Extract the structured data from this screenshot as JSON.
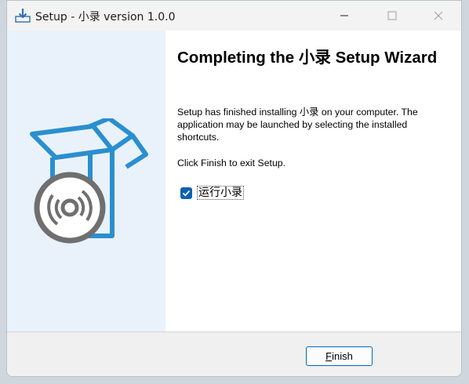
{
  "window": {
    "title": "Setup - 小录 version 1.0.0",
    "minimize_icon": "minimize-icon",
    "maximize_icon": "maximize-icon",
    "close_icon": "close-icon"
  },
  "wizard": {
    "heading": "Completing the 小录 Setup Wizard",
    "message": "Setup has finished installing 小录 on your computer. The application may be launched by selecting the installed shortcuts.",
    "exit_text": "Click Finish to exit Setup.",
    "run_checkbox": {
      "label": "运行小录",
      "checked": true
    }
  },
  "footer": {
    "finish_access_key": "F",
    "finish_rest": "inish"
  },
  "colors": {
    "accent": "#0067c0",
    "checkbox": "#0a62b0",
    "box_blue": "#2a8fd0",
    "disc_gray": "#6f6f6f",
    "sidepanel": "#e9f2fa"
  }
}
